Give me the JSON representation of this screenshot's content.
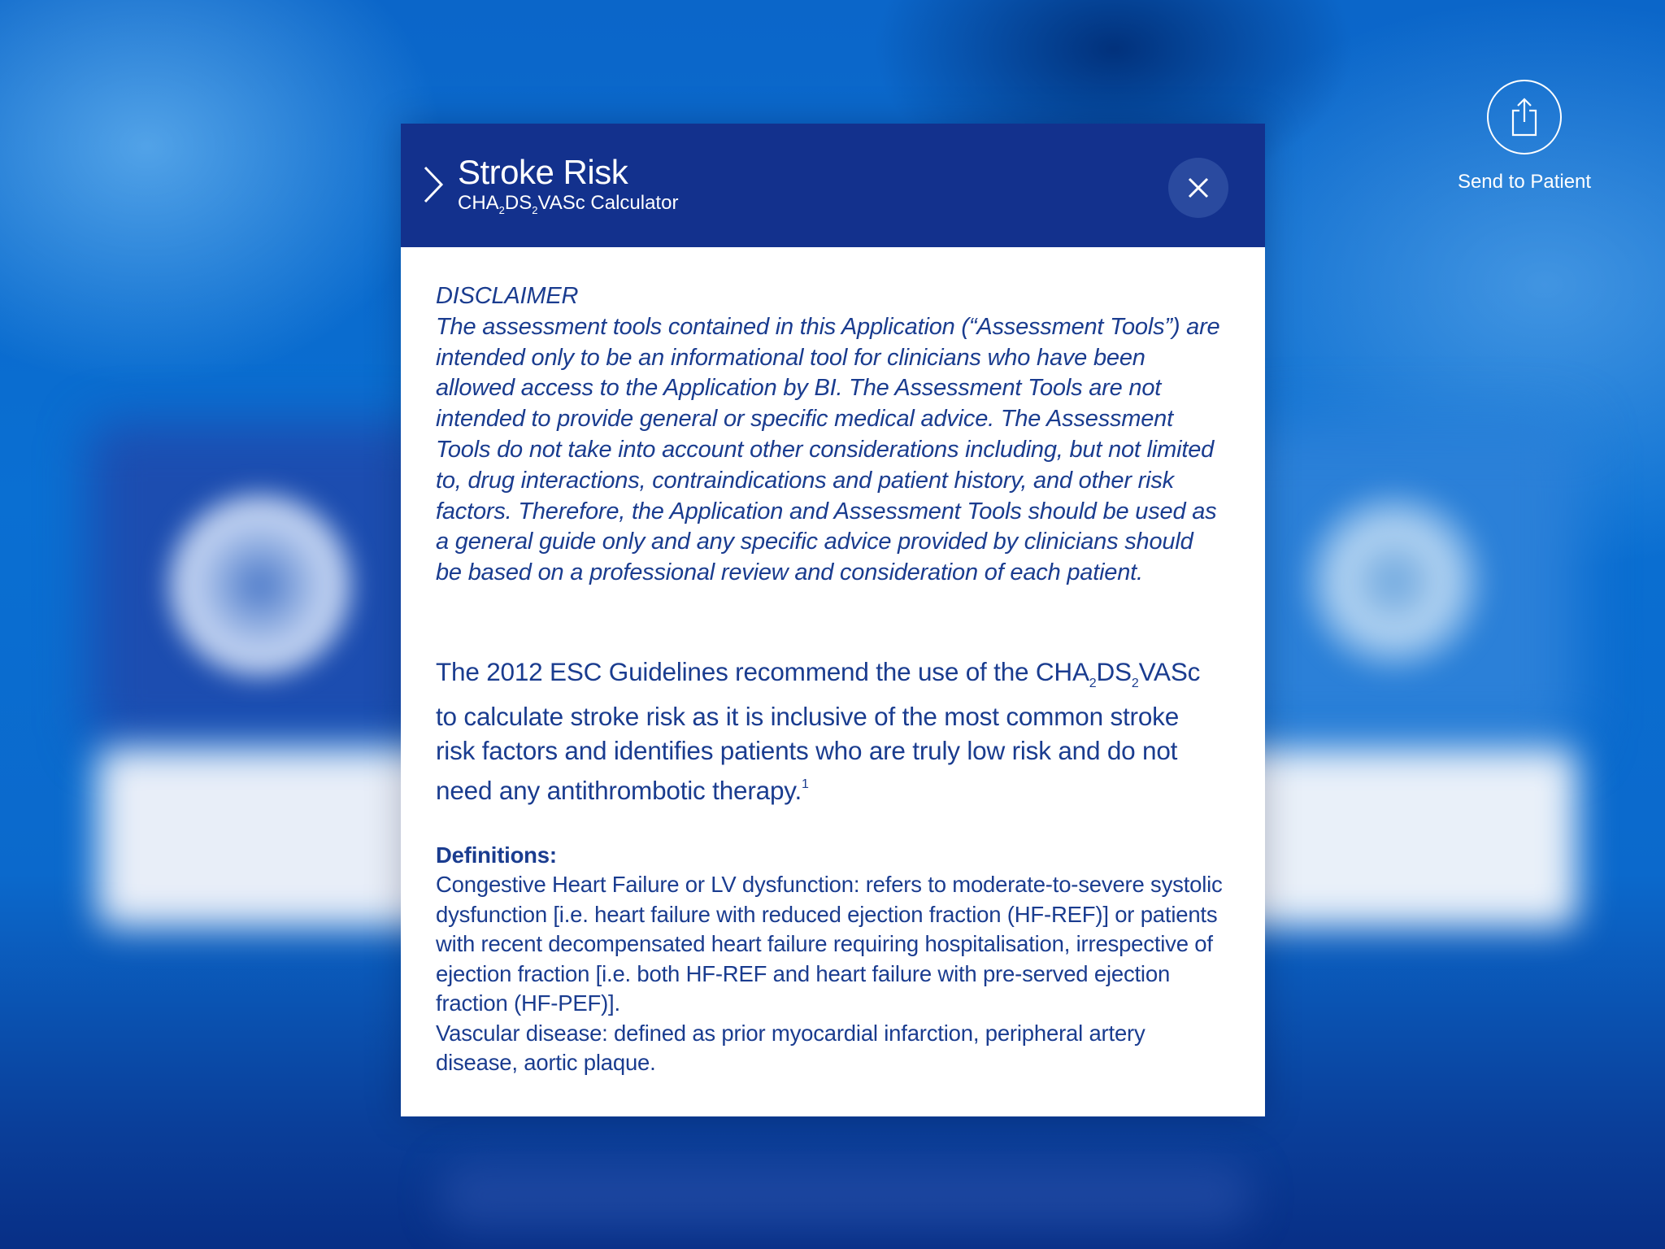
{
  "send": {
    "label": "Send to Patient",
    "icon": "share-icon"
  },
  "modal": {
    "title": "Stroke Risk",
    "subtitle": {
      "p1": "CHA",
      "s1": "2",
      "p2": "DS",
      "s2": "2",
      "p3": "VASc Calculator"
    },
    "close_icon": "close-icon",
    "header_color": "#13318d"
  },
  "disclaimer": {
    "title": "DISCLAIMER",
    "text": "The assessment tools contained in this Application (“Assessment Tools”) are intended only to be an informational tool for clinicians who have been allowed access to the Application by BI. The Assessment Tools are not intended to provide general or specific medical advice. The Assessment Tools do not take into account other considerations including, but not limited to, drug interactions, contraindications and patient history, and other risk factors. Therefore, the Application and Assessment Tools should be used as a general guide only and any specific advice provided by clinicians should be based on a professional review and consideration of each patient."
  },
  "intro": {
    "p1": "The 2012 ESC Guidelines recommend the use of the CHA",
    "s1": "2",
    "p2": "DS",
    "s2": "2",
    "p3": "VASc to calculate stroke risk as it is inclusive of the most common stroke risk factors and identifies patients who are truly low risk and do not need any antithrombotic therapy.",
    "ref": "1"
  },
  "definitions": {
    "title": "Definitions:",
    "items": [
      "Congestive Heart Failure or LV dysfunction: refers to moderate-to-severe systolic dysfunction [i.e. heart failure with reduced ejection fraction (HF-REF)] or patients with recent decompensated heart failure requiring hospitalisation, irrespective of ejection fraction [i.e. both HF-REF and heart failure with pre-served ejection fraction (HF-PEF)].",
      "Vascular disease: defined as prior myocardial infarction, peripheral artery disease, aortic plaque."
    ]
  }
}
